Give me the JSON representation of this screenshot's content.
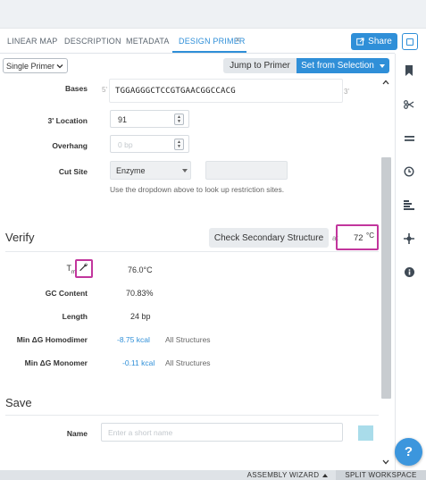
{
  "tabs": [
    {
      "label": "LINEAR MAP"
    },
    {
      "label": "DESCRIPTION"
    },
    {
      "label": "METADATA"
    },
    {
      "label": "DESIGN PRIMER"
    }
  ],
  "tab_close": "×",
  "share_label": "Share",
  "primer_mode": {
    "selected": "Single Primer"
  },
  "jump_label": "Jump to Primer",
  "set_selection_label": "Set from Selection",
  "bases": {
    "label": "Bases",
    "prefix": "5'",
    "sequence": "TGGAGGGCTCCGTGAACGGCCACG",
    "suffix": "3'"
  },
  "location": {
    "label": "3' Location",
    "value": "91"
  },
  "overhang": {
    "label": "Overhang",
    "placeholder": "0 bp"
  },
  "cut_site": {
    "label": "Cut Site",
    "selected": "Enzyme",
    "hint": "Use the dropdown above to look up restriction sites."
  },
  "verify": {
    "title": "Verify",
    "check_label": "Check Secondary Structure",
    "temp_prefix": "at",
    "temp_value": "72",
    "temp_unit": "°C",
    "tm_label": "T",
    "tm_sub": "m",
    "tm_value": "76.0°C",
    "gc_label": "GC Content",
    "gc_value": "70.83%",
    "length_label": "Length",
    "length_value": "24 bp",
    "homodimer_label": "Min ΔG Homodimer",
    "homodimer_value": "-8.75 kcal",
    "homodimer_scope": "All Structures",
    "monomer_label": "Min ΔG Monomer",
    "monomer_value": "-0.11 kcal",
    "monomer_scope": "All Structures"
  },
  "save": {
    "title": "Save",
    "name_label": "Name",
    "name_placeholder": "Enter a short name"
  },
  "bottom": {
    "assembly": "ASSEMBLY WIZARD",
    "split": "SPLIT WORKSPACE"
  },
  "help_label": "?",
  "colors": {
    "accent": "#2f8fd8",
    "highlight": "#c2369d",
    "swatch": "#a9dcea"
  },
  "rail_icons": [
    "bookmark-icon",
    "scissors-icon",
    "equals-icon",
    "clock-icon",
    "bars-icon",
    "crosshair-icon",
    "info-icon"
  ]
}
